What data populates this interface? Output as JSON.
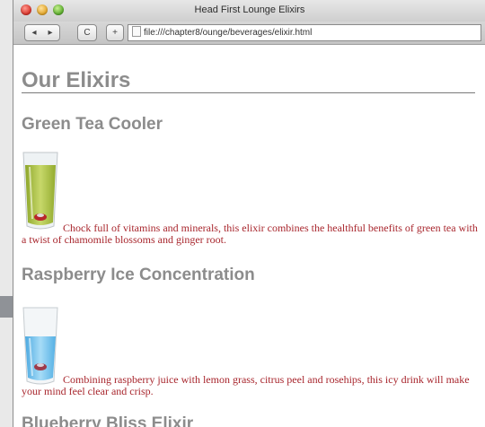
{
  "window": {
    "title": "Head First Lounge Elixirs",
    "url": "file:///chapter8/ounge/beverages/elixir.html"
  },
  "toolbar": {
    "back_glyph": "◂",
    "forward_glyph": "▸",
    "reload_glyph": "C",
    "add_glyph": "+"
  },
  "page": {
    "heading": "Our Elixirs",
    "items": [
      {
        "name": "Green Tea Cooler",
        "description": "Chock full of vitamins and minerals, this elixir combines the healthful benefits of green tea with a twist of chamomile blossoms and ginger root.",
        "icon": "green-tea-glass"
      },
      {
        "name": "Raspberry Ice Concentration",
        "description": "Combining raspberry juice with lemon grass, citrus peel and rosehips, this icy drink will make your mind feel clear and crisp.",
        "icon": "raspberry-glass"
      },
      {
        "name": "Blueberry Bliss Elixir"
      }
    ]
  },
  "colors": {
    "heading": "#8c8c8c",
    "body_text": "#a8262d",
    "green_drink": "#a4ba3c",
    "blue_drink": "#74c4f0"
  }
}
